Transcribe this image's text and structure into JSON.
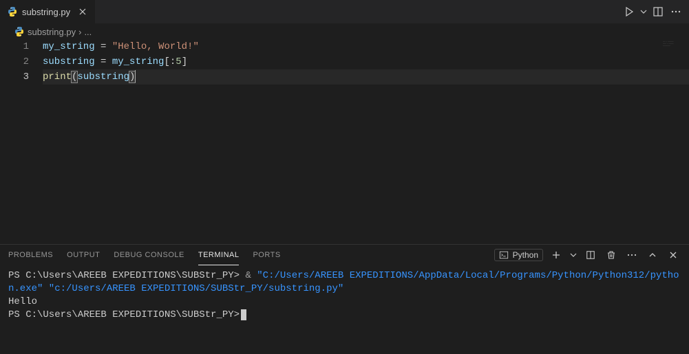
{
  "tab": {
    "filename": "substring.py",
    "lang_icon": "python-icon"
  },
  "breadcrumb": {
    "filename": "substring.py",
    "rest": "..."
  },
  "editor": {
    "line_numbers": [
      "1",
      "2",
      "3"
    ],
    "active_line": 3,
    "lines": [
      [
        {
          "cls": "tok-var",
          "t": "my_string"
        },
        {
          "cls": "tok-op",
          "t": " = "
        },
        {
          "cls": "tok-str",
          "t": "\"Hello, World!\""
        }
      ],
      [
        {
          "cls": "tok-var",
          "t": "substring"
        },
        {
          "cls": "tok-op",
          "t": " = "
        },
        {
          "cls": "tok-var",
          "t": "my_string"
        },
        {
          "cls": "tok-punct",
          "t": "[:"
        },
        {
          "cls": "tok-num",
          "t": "5"
        },
        {
          "cls": "tok-punct",
          "t": "]"
        }
      ],
      [
        {
          "cls": "tok-func",
          "t": "print"
        },
        {
          "cls": "tok-punct bracket-match",
          "t": "("
        },
        {
          "cls": "tok-var",
          "t": "substring"
        },
        {
          "cls": "tok-punct bracket-match",
          "t": ")"
        }
      ]
    ]
  },
  "panel": {
    "tabs": {
      "problems": "PROBLEMS",
      "output": "OUTPUT",
      "debug_console": "DEBUG CONSOLE",
      "terminal": "TERMINAL",
      "ports": "PORTS"
    },
    "launcher": "Python"
  },
  "terminal": {
    "prompt_prefix": "PS ",
    "cwd": "C:\\Users\\AREEB EXPEDITIONS\\SUBStr_PY",
    "amp": "&",
    "cmd_part1": "\"C:/Users/AREEB EXPEDITIONS/AppData/Local/Programs/Python/Python312/python.exe\"",
    "cmd_part2": "\"c:/Users/AREEB EXPEDITIONS/SUBStr_PY/substring.py\"",
    "output": "Hello"
  }
}
